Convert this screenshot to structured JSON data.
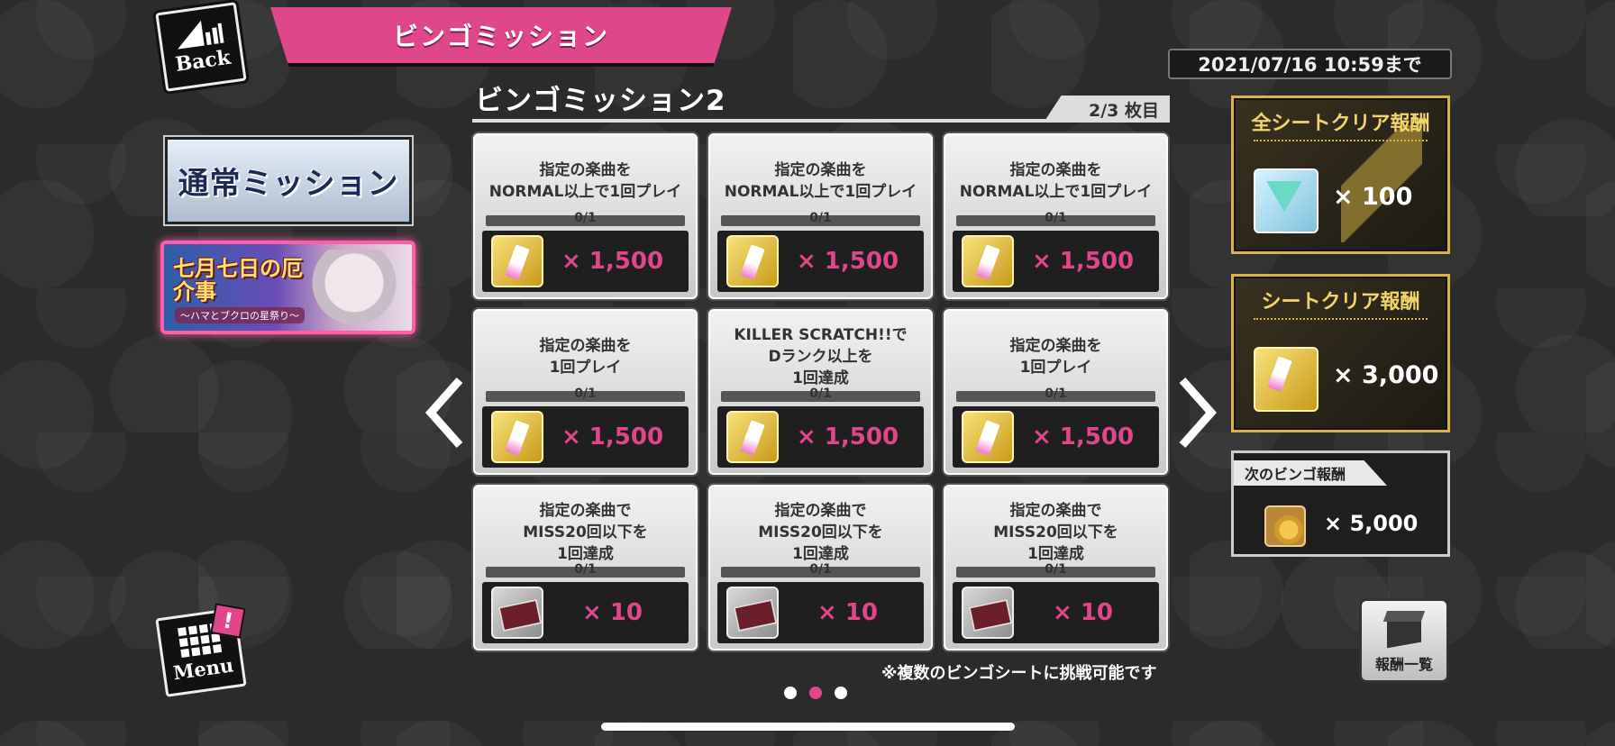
{
  "header": {
    "back_label": "Back",
    "title": "ビンゴミッション",
    "deadline": "2021/07/16 10:59まで"
  },
  "left": {
    "normal_mission_label": "通常ミッション",
    "event_banner_title": "七月七日の厄介事",
    "event_banner_subtitle": "〜ハマとブクロの星祭り〜",
    "menu_label": "Menu",
    "menu_badge": "!"
  },
  "sheet": {
    "title": "ビンゴミッション2",
    "page": "2/3 枚目",
    "cells": [
      {
        "condition": "指定の楽曲を\nNORMAL以上で1回プレイ",
        "progress": "0/1",
        "reward_icon": "fuda-icon",
        "amount": "× 1,500"
      },
      {
        "condition": "指定の楽曲を\nNORMAL以上で1回プレイ",
        "progress": "0/1",
        "reward_icon": "fuda-icon",
        "amount": "× 1,500"
      },
      {
        "condition": "指定の楽曲を\nNORMAL以上で1回プレイ",
        "progress": "0/1",
        "reward_icon": "fuda-icon",
        "amount": "× 1,500"
      },
      {
        "condition": "指定の楽曲を\n1回プレイ",
        "progress": "0/1",
        "reward_icon": "fuda-icon",
        "amount": "× 1,500"
      },
      {
        "condition": "KILLER SCRATCH!!で\nDランク以上を\n1回達成",
        "progress": "0/1",
        "reward_icon": "fuda-icon",
        "amount": "× 1,500"
      },
      {
        "condition": "指定の楽曲を\n1回プレイ",
        "progress": "0/1",
        "reward_icon": "fuda-icon",
        "amount": "× 1,500"
      },
      {
        "condition": "指定の楽曲で\nMISS20回以下を\n1回達成",
        "progress": "0/1",
        "reward_icon": "ticket-icon",
        "amount": "× 10"
      },
      {
        "condition": "指定の楽曲で\nMISS20回以下を\n1回達成",
        "progress": "0/1",
        "reward_icon": "ticket-icon",
        "amount": "× 10"
      },
      {
        "condition": "指定の楽曲で\nMISS20回以下を\n1回達成",
        "progress": "0/1",
        "reward_icon": "ticket-icon",
        "amount": "× 10"
      }
    ],
    "note": "※複数のビンゴシートに挑戦可能です",
    "pager": {
      "count": 3,
      "active": 2
    }
  },
  "right": {
    "all_clear": {
      "title": "全シートクリア報酬",
      "icon": "gem-icon",
      "amount": "× 100"
    },
    "sheet_clear": {
      "title": "シートクリア報酬",
      "icon": "fuda-icon",
      "amount": "× 3,000"
    },
    "next_bingo": {
      "title": "次のビンゴ報酬",
      "icon": "coin-icon",
      "amount": "× 5,000"
    },
    "reward_list_label": "報酬一覧"
  },
  "colors": {
    "accent": "#e0468a",
    "gold": "#d8b443"
  }
}
